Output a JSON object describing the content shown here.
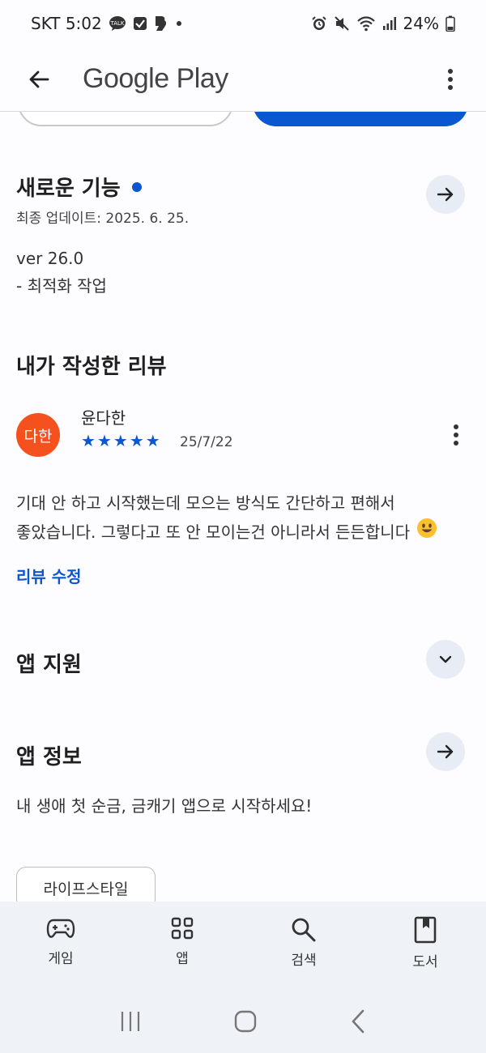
{
  "status_bar": {
    "carrier_time": "SKT 5:02",
    "battery_text": "24%",
    "left_icons": [
      "talk-icon",
      "check-icon",
      "b-icon",
      "dot-icon"
    ],
    "right_icons": [
      "alarm-icon",
      "mute-icon",
      "wifi-icon",
      "signal-icon",
      "battery-icon"
    ]
  },
  "app_bar": {
    "title": "Google Play"
  },
  "whats_new": {
    "title": "새로운 기능",
    "updated": "최종 업데이트: 2025. 6. 25.",
    "version": "ver 26.0",
    "note": "- 최적화 작업"
  },
  "my_review": {
    "title": "내가 작성한 리뷰",
    "avatar_text": "다한",
    "reviewer": "윤다한",
    "rating": 5,
    "stars": [
      "★",
      "★",
      "★",
      "★",
      "★"
    ],
    "date": "25/7/22",
    "text_line1": "기대 안 하고 시작했는데 모으는 방식도 간단하고 편해서",
    "text_line2": "좋았습니다. 그렇다고 또 안 모이는건 아니라서 든든합니다",
    "edit_label": "리뷰 수정"
  },
  "app_support": {
    "title": "앱 지원"
  },
  "app_info": {
    "title": "앱 정보",
    "description": "내 생애 첫 순금, 금캐기 앱으로 시작하세요!",
    "chip": "라이프스타일"
  },
  "bottom_nav": {
    "items": [
      {
        "label": "게임",
        "icon": "gamepad-icon"
      },
      {
        "label": "앱",
        "icon": "apps-grid-icon"
      },
      {
        "label": "검색",
        "icon": "search-icon"
      },
      {
        "label": "도서",
        "icon": "book-icon"
      }
    ]
  },
  "colors": {
    "accent": "#0b57d0",
    "avatar": "#f4511e",
    "nav_bg": "#eff3f8",
    "round_btn": "#e8ecf5"
  }
}
